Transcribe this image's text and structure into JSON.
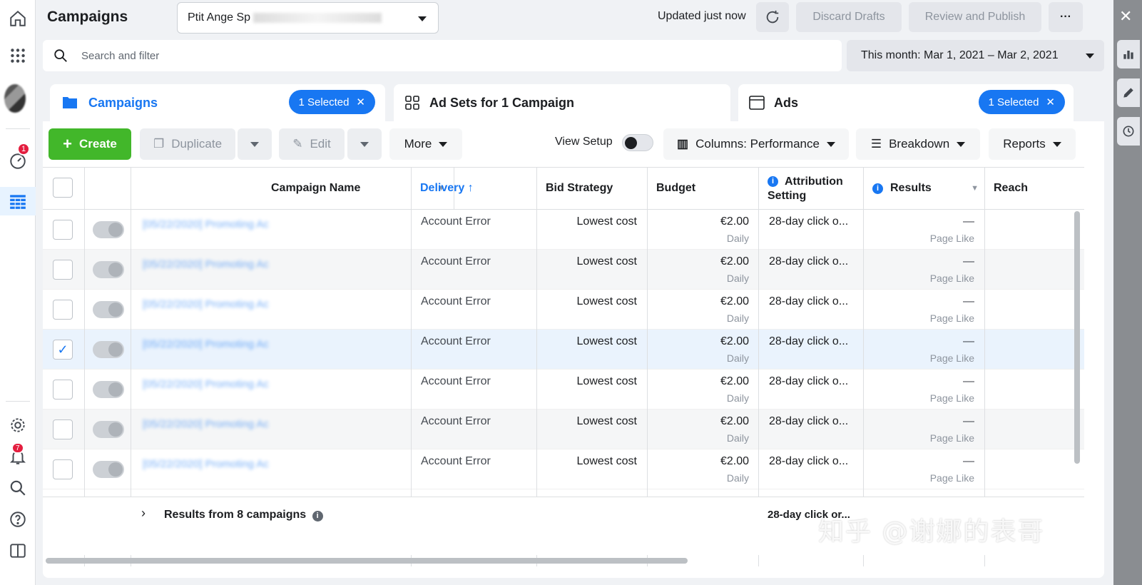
{
  "header": {
    "title": "Campaigns",
    "account": "Ptit Ange Sp",
    "updated": "Updated just now",
    "discard_label": "Discard Drafts",
    "review_label": "Review and Publish",
    "more_label": "···"
  },
  "search": {
    "placeholder": "Search and filter"
  },
  "date_range": "This month: Mar 1, 2021 – Mar 2, 2021",
  "tabs": {
    "campaigns": {
      "label": "Campaigns",
      "pill": "1 Selected"
    },
    "adsets": {
      "label": "Ad Sets for 1 Campaign"
    },
    "ads": {
      "label": "Ads",
      "pill": "1 Selected"
    }
  },
  "toolbar": {
    "create": "Create",
    "duplicate": "Duplicate",
    "edit": "Edit",
    "more": "More",
    "view_setup": "View Setup",
    "columns": "Columns: Performance",
    "breakdown": "Breakdown",
    "reports": "Reports"
  },
  "columns": {
    "name": "Campaign Name",
    "delivery": "Delivery ↑",
    "bid": "Bid Strategy",
    "budget": "Budget",
    "attribution": "Attribution Setting",
    "results": "Results",
    "reach": "Reach"
  },
  "rows": [
    {
      "name": "[05/22/2020] Promoting Ac",
      "delivery": "Account Error",
      "bid": "Lowest cost",
      "budget": "€2.00",
      "budget_type": "Daily",
      "attribution": "28-day click o...",
      "results": "—",
      "results_type": "Page Like",
      "checked": false
    },
    {
      "name": "[05/22/2020] Promoting Ac",
      "delivery": "Account Error",
      "bid": "Lowest cost",
      "budget": "€2.00",
      "budget_type": "Daily",
      "attribution": "28-day click o...",
      "results": "—",
      "results_type": "Page Like",
      "checked": false
    },
    {
      "name": "[05/22/2020] Promoting Ac",
      "delivery": "Account Error",
      "bid": "Lowest cost",
      "budget": "€2.00",
      "budget_type": "Daily",
      "attribution": "28-day click o...",
      "results": "—",
      "results_type": "Page Like",
      "checked": false
    },
    {
      "name": "[05/22/2020] Promoting Ac",
      "delivery": "Account Error",
      "bid": "Lowest cost",
      "budget": "€2.00",
      "budget_type": "Daily",
      "attribution": "28-day click o...",
      "results": "—",
      "results_type": "Page Like",
      "checked": true
    },
    {
      "name": "[05/22/2020] Promoting Ac",
      "delivery": "Account Error",
      "bid": "Lowest cost",
      "budget": "€2.00",
      "budget_type": "Daily",
      "attribution": "28-day click o...",
      "results": "—",
      "results_type": "Page Like",
      "checked": false
    },
    {
      "name": "[05/22/2020] Promoting Ac",
      "delivery": "Account Error",
      "bid": "Lowest cost",
      "budget": "€2.00",
      "budget_type": "Daily",
      "attribution": "28-day click o...",
      "results": "—",
      "results_type": "Page Like",
      "checked": false
    },
    {
      "name": "[05/22/2020] Promoting Ac",
      "delivery": "Account Error",
      "bid": "Lowest cost",
      "budget": "€2.00",
      "budget_type": "Daily",
      "attribution": "28-day click o...",
      "results": "—",
      "results_type": "Page Like",
      "checked": false
    }
  ],
  "footer": {
    "summary": "Results from 8 campaigns",
    "attribution": "28-day click or..."
  },
  "nav": {
    "ads_badge": "1",
    "notifications_badge": "7"
  },
  "watermark": "知乎 @谢娜的表哥",
  "colors": {
    "accent": "#1877f2",
    "create": "#42b72a",
    "badge": "#e41e3f"
  }
}
